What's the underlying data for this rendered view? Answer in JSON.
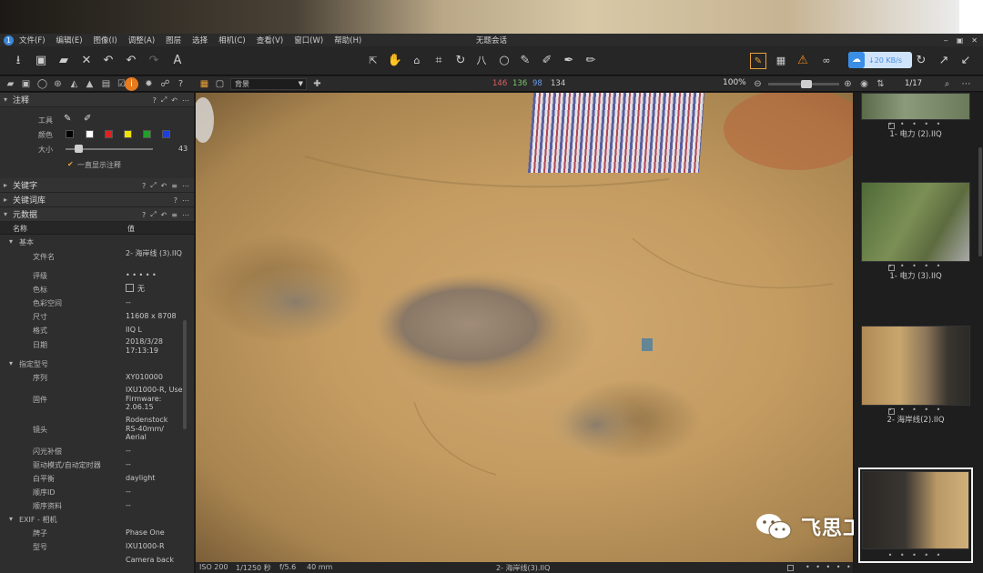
{
  "app": {
    "window_title": "无题会话",
    "menu": [
      "文件(F)",
      "编辑(E)",
      "图像(I)",
      "调整(A)",
      "图层",
      "选择",
      "相机(C)",
      "查看(V)",
      "窗口(W)",
      "帮助(H)"
    ],
    "cloud_speed": "↓20 KB/s"
  },
  "subbar": {
    "layer": "背景",
    "rgb": {
      "r": "146",
      "g": "136",
      "b": "98",
      "l": "134"
    },
    "zoom": "100%",
    "page": "1/17"
  },
  "annotation": {
    "title": "注释",
    "tool_label": "工具",
    "color_label": "颜色",
    "size_label": "大小",
    "size_value": "43",
    "size_level": 0.15,
    "always_show": "一直显示注释",
    "colors": [
      "#000000",
      "#ffffff",
      "#e02020",
      "#f2e200",
      "#22a02a",
      "#1d3fe0"
    ]
  },
  "sections": {
    "keywords": "关键字",
    "keyword_lib": "关键词库",
    "metadata": "元数据"
  },
  "metadata": {
    "col_name": "名称",
    "col_value": "值",
    "group_basic": "基本",
    "basic": [
      {
        "k": "文件名",
        "v": "2- 海岸线 (3).IIQ"
      },
      {
        "k": "评级",
        "v": "• • • • •"
      },
      {
        "k": "色标",
        "v": "无"
      },
      {
        "k": "色彩空间",
        "v": "--"
      },
      {
        "k": "尺寸",
        "v": "11608 x 8708"
      },
      {
        "k": "格式",
        "v": "IIQ L"
      },
      {
        "k": "日期",
        "v": "2018/3/28 17:13:19"
      }
    ],
    "group_model": "指定型号",
    "model": [
      {
        "k": "序列",
        "v": "XY010000"
      },
      {
        "k": "固件",
        "v": "IXU1000-R, User Firmware: 2.06.15"
      },
      {
        "k": "镜头",
        "v": "Rodenstock RS-40mm/ Aerial"
      },
      {
        "k": "闪光补偿",
        "v": "--"
      },
      {
        "k": "驱动模式/自动定时器",
        "v": "--"
      },
      {
        "k": "白平衡",
        "v": "daylight"
      },
      {
        "k": "顺序ID",
        "v": "--"
      },
      {
        "k": "顺序资料",
        "v": "--"
      }
    ],
    "group_exif": "EXIF - 相机",
    "exif": [
      {
        "k": "牌子",
        "v": "Phase One"
      },
      {
        "k": "型号",
        "v": "IXU1000-R"
      },
      {
        "k": "",
        "v": "Camera back"
      }
    ]
  },
  "status": {
    "iso": "ISO 200",
    "shutter": "1/1250 秒",
    "aperture": "f/5.6",
    "focal": "40 mm",
    "filename": "2- 海岸线(3).IIQ"
  },
  "browser": {
    "thumbs": [
      {
        "name": "1- 电力 (2).IIQ",
        "stars": "• • • • •"
      },
      {
        "name": "1- 电力 (3).IIQ",
        "stars": "• • • • •"
      },
      {
        "name": "2- 海岸线(2).IIQ",
        "stars": "• • • • •"
      },
      {
        "name": "",
        "stars": "• • • • •"
      }
    ]
  },
  "watermark": {
    "text": "飞思工业相机"
  }
}
